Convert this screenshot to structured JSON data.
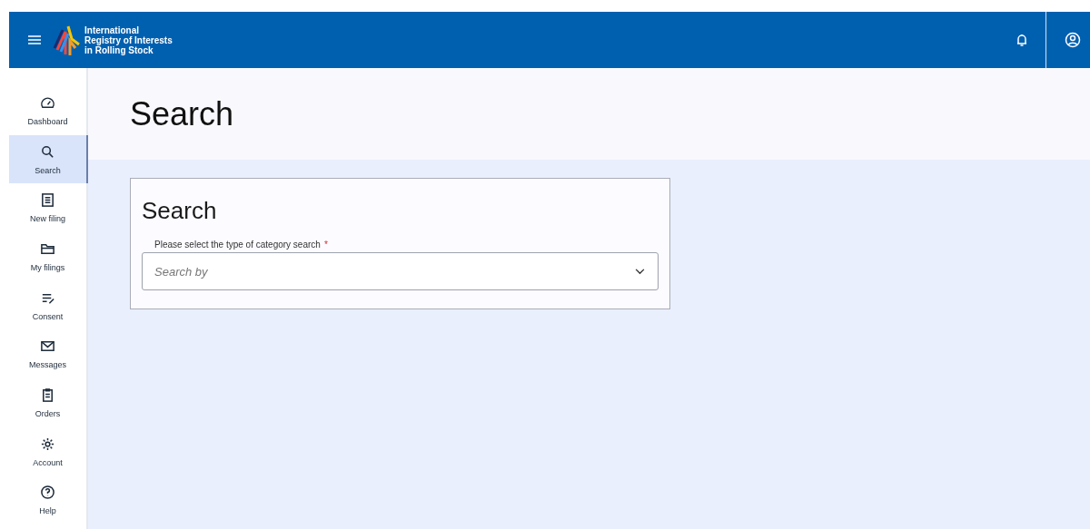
{
  "header": {
    "brand_lines": [
      "International",
      "Registry of Interests",
      "in Rolling Stock"
    ]
  },
  "sidebar": {
    "items": [
      {
        "label": "Dashboard",
        "selected": false
      },
      {
        "label": "Search",
        "selected": true
      },
      {
        "label": "New filing",
        "selected": false
      },
      {
        "label": "My filings",
        "selected": false
      },
      {
        "label": "Consent",
        "selected": false
      },
      {
        "label": "Messages",
        "selected": false
      },
      {
        "label": "Orders",
        "selected": false
      },
      {
        "label": "Account",
        "selected": false
      },
      {
        "label": "Help",
        "selected": false
      }
    ]
  },
  "page_title": "Search",
  "card": {
    "title": "Search",
    "field": {
      "label": "Please select the type of category search",
      "required_mark": "*",
      "placeholder": "Search by"
    }
  }
}
